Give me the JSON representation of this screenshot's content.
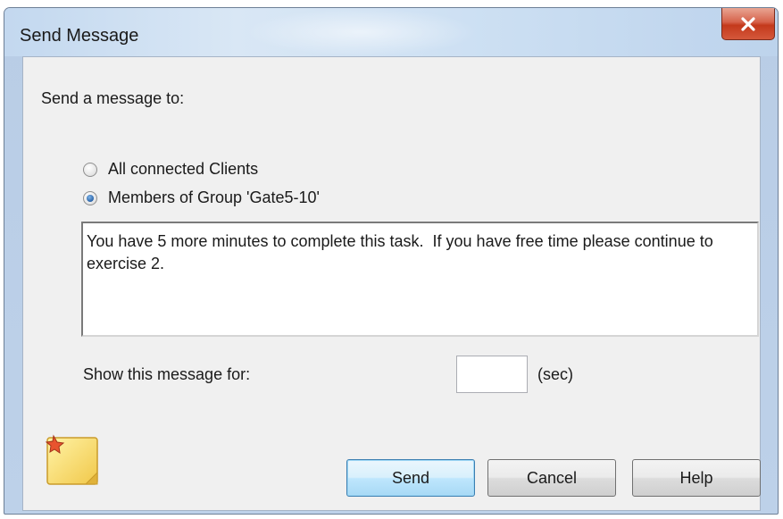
{
  "window": {
    "title": "Send Message",
    "close_label": "Close"
  },
  "recipients": {
    "heading": "Send a message to:",
    "options": [
      {
        "label": "All connected Clients",
        "selected": false
      },
      {
        "label": "Members of Group 'Gate5-10'",
        "selected": true
      }
    ]
  },
  "message": {
    "text": "You have 5 more minutes to complete this task.  If you have free time please continue to exercise 2."
  },
  "duration": {
    "label": "Show this message for:",
    "value": "",
    "unit": "(sec)"
  },
  "buttons": {
    "send": "Send",
    "cancel": "Cancel",
    "help": "Help"
  },
  "icons": {
    "close": "close-icon",
    "note": "sticky-note-icon"
  },
  "colors": {
    "accent": "#3c7fb1",
    "close_red": "#c4391c",
    "title_bar": "#c3d8ef"
  }
}
